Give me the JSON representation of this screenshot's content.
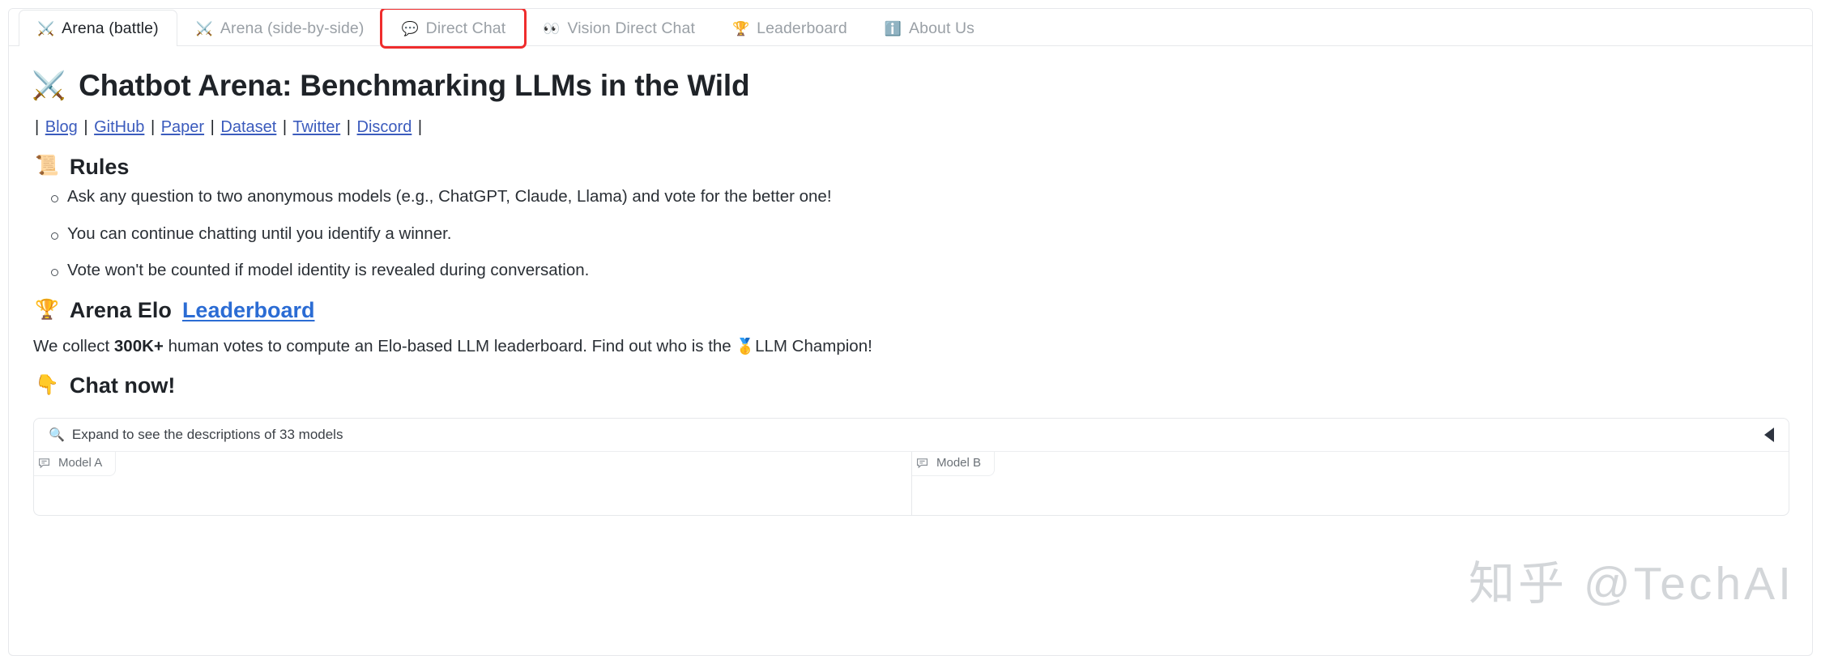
{
  "tabs": [
    {
      "id": "arena-battle",
      "icon": "⚔️",
      "label": "Arena (battle)",
      "active": true,
      "highlighted": false
    },
    {
      "id": "arena-side-by-side",
      "icon": "⚔️",
      "label": "Arena (side-by-side)",
      "active": false,
      "highlighted": false
    },
    {
      "id": "direct-chat",
      "icon": "💬",
      "label": "Direct Chat",
      "active": false,
      "highlighted": true
    },
    {
      "id": "vision-direct-chat",
      "icon": "👀",
      "label": "Vision Direct Chat",
      "active": false,
      "highlighted": false
    },
    {
      "id": "leaderboard",
      "icon": "🏆",
      "label": "Leaderboard",
      "active": false,
      "highlighted": false
    },
    {
      "id": "about-us",
      "icon": "ℹ️",
      "label": "About Us",
      "active": false,
      "highlighted": false
    }
  ],
  "header": {
    "icon": "⚔️",
    "title": "Chatbot Arena: Benchmarking LLMs in the Wild"
  },
  "links": {
    "leading_sep": "|",
    "trailing_sep": "|",
    "separator": "|",
    "items": [
      {
        "label": "Blog"
      },
      {
        "label": "GitHub"
      },
      {
        "label": "Paper"
      },
      {
        "label": "Dataset"
      },
      {
        "label": "Twitter"
      },
      {
        "label": "Discord"
      }
    ]
  },
  "rules": {
    "icon": "📜",
    "heading": "Rules",
    "items": [
      "Ask any question to two anonymous models (e.g., ChatGPT, Claude, Llama) and vote for the better one!",
      "You can continue chatting until you identify a winner.",
      "Vote won't be counted if model identity is revealed during conversation."
    ]
  },
  "elo": {
    "icon": "🏆",
    "heading_text": "Arena Elo ",
    "heading_link": "Leaderboard",
    "blurb_before": "We collect ",
    "blurb_bold": "300K+",
    "blurb_middle": " human votes to compute an Elo-based LLM leaderboard. Find out who is the ",
    "blurb_emoji": "🥇",
    "blurb_after": "LLM Champion!"
  },
  "chat_now": {
    "icon": "👇",
    "heading": "Chat now!"
  },
  "accordion": {
    "magnifier_icon": "🔍",
    "label": "Expand to see the descriptions of 33 models",
    "toggle_icon": "left-triangle",
    "expanded": false
  },
  "chat_columns": [
    {
      "id": "model-a",
      "label": "Model A",
      "icon": "chat-bubble-icon"
    },
    {
      "id": "model-b",
      "label": "Model B",
      "icon": "chat-bubble-icon"
    }
  ],
  "watermark": {
    "text": "知乎 @TechAI"
  },
  "colors": {
    "accent_link": "#3b5bbd",
    "heading_link": "#2b6cd4",
    "highlight_outline": "#ef2d2d",
    "text_primary": "#1f2328",
    "text_muted": "#9aa0a6",
    "border": "#e6e8eb"
  }
}
